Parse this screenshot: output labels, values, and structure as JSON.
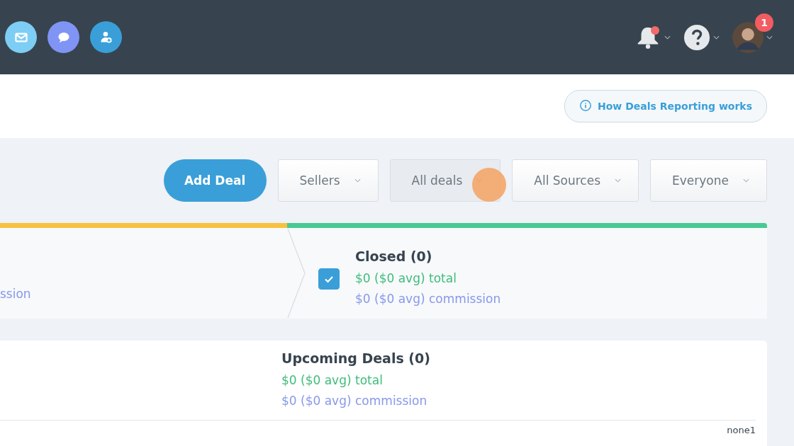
{
  "topbar": {
    "apps": [
      {
        "kind": "mail",
        "color": "#7ecdf5"
      },
      {
        "kind": "chat",
        "color": "#7f94f5"
      },
      {
        "kind": "person",
        "color": "#3a9fd8"
      }
    ],
    "notifications": {
      "unread": true
    },
    "profile": {
      "badge": "1"
    }
  },
  "help_link": "How Deals Reporting works",
  "toolbar": {
    "add_button": "Add Deal",
    "filters": [
      {
        "label": "Sellers",
        "selected": false
      },
      {
        "label": "All deals",
        "selected": true
      },
      {
        "label": "All Sources",
        "selected": false
      },
      {
        "label": "Everyone",
        "selected": false
      }
    ]
  },
  "stages": [
    {
      "color": "#f7c23f",
      "lines": [
        {
          "kind": "commission",
          "text": "ssion"
        }
      ]
    },
    {
      "color": "#47c993",
      "checked": true,
      "title": "Closed (0)",
      "lines": [
        {
          "kind": "total",
          "text": "$0 ($0 avg) total"
        },
        {
          "kind": "commission",
          "text": "$0 ($0 avg) commission"
        }
      ]
    }
  ],
  "upcoming": {
    "title": "Upcoming Deals (0)",
    "lines": [
      {
        "kind": "total",
        "text": "$0 ($0 avg) total"
      },
      {
        "kind": "commission",
        "text": "$0 ($0 avg) commission"
      }
    ],
    "footer": "none1"
  }
}
